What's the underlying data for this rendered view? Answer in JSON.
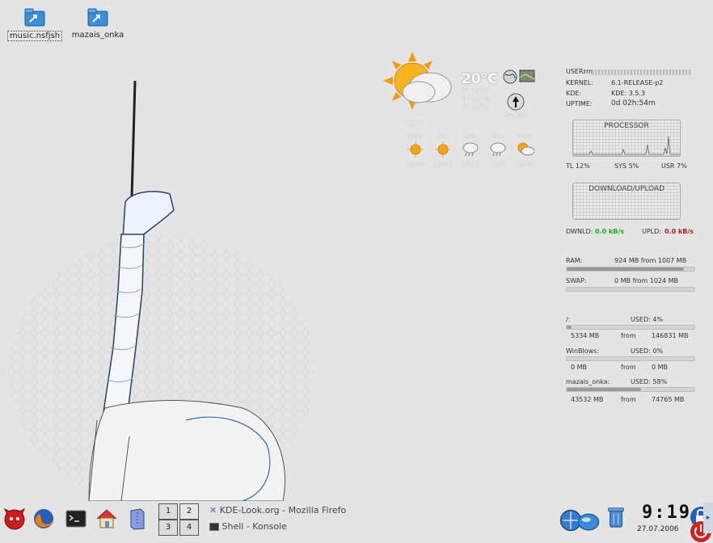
{
  "desktop": {
    "icons": [
      {
        "label": "music.nsfjsh",
        "selected": true
      },
      {
        "label": "mazais_onka",
        "selected": false
      }
    ]
  },
  "weather": {
    "temp": "20°C",
    "pressure": "P: 1017",
    "humidity": "H: 64 %",
    "realfeel": "R: 20°C",
    "wind": "34 kph",
    "city": "Riga",
    "forecast": [
      {
        "day": "2day:",
        "temps": "11/20",
        "icon": "sun-icon"
      },
      {
        "day": "Fri:",
        "temps": "16/22",
        "icon": "sun-icon"
      },
      {
        "day": "Sat:",
        "temps": "13/22",
        "icon": "storm-icon"
      },
      {
        "day": "Sun:",
        "temps": "13/21",
        "icon": "storm-icon"
      },
      {
        "day": "Mon:",
        "temps": "13/25",
        "icon": "partly-cloudy-icon"
      }
    ]
  },
  "sysinfo": {
    "user_label": "USER:",
    "user_value": "rm",
    "kernel_label": "KERNEL:",
    "kernel_value": "6.1-RELEASE-p2",
    "kde_label": "KDE:",
    "kde_value": "KDE: 3.5.3",
    "uptime_label": "UPTIME:",
    "uptime_value": "0d  02h:54m"
  },
  "processor": {
    "title": "PROCESSOR",
    "tl": "TL 12%",
    "sys": "SYS 5%",
    "usr": "USR 7%"
  },
  "network": {
    "title": "DOWNLOAD/UPLOAD",
    "down_label": "DWNLD:",
    "down_value": "0.0 kB/s",
    "up_label": "UPLD:",
    "up_value": "0.0 kB/s",
    "down_color": "#22aa22",
    "up_color": "#aa2222"
  },
  "memory": {
    "ram_label": "RAM:",
    "ram_value": "924 MB from 1007 MB",
    "ram_fraction": 0.92,
    "swap_label": "SWAP:",
    "swap_value": "0 MB from 1024 MB",
    "swap_fraction": 0.0
  },
  "disks": [
    {
      "name": "/:",
      "used": "USED: 4%",
      "size": "5334 MB",
      "from": "from",
      "total": "146831 MB",
      "fraction": 0.04
    },
    {
      "name": "WinBlows:",
      "used": "USED: 0%",
      "size": "0 MB",
      "from": "from",
      "total": "0 MB",
      "fraction": 0.0
    },
    {
      "name": "mazais_onka:",
      "used": "USED: 58%",
      "size": "43532 MB",
      "from": "from",
      "total": "74765 MB",
      "fraction": 0.58
    }
  ],
  "taskbar": {
    "pager": [
      "1",
      "2",
      "3",
      "4"
    ],
    "tasks": [
      {
        "label": "KDE-Look.org - Mozilla Firefo",
        "icon": "firefox-window-icon"
      },
      {
        "label": "Shell - Konsole",
        "icon": "konsole-window-icon"
      }
    ],
    "clock_time": "9:19",
    "clock_date": "27.07.2006"
  }
}
